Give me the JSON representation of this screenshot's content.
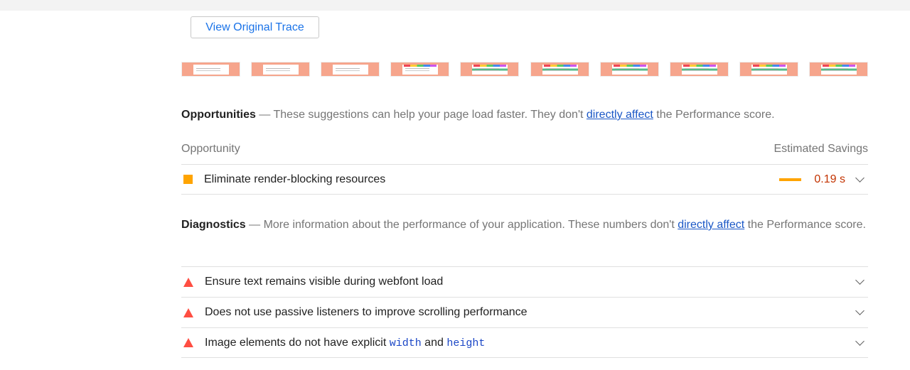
{
  "trace_button": {
    "label": "View Original Trace"
  },
  "filmstrip": {
    "frames": [
      "plain",
      "plain",
      "plain",
      "rich",
      "green",
      "green",
      "green",
      "green",
      "green",
      "green"
    ]
  },
  "opportunities": {
    "title": "Opportunities",
    "dash": " — ",
    "desc_before": "These suggestions can help your page load faster. They don't ",
    "link": "directly affect",
    "desc_after": " the Performance score.",
    "col_left": "Opportunity",
    "col_right": "Estimated Savings",
    "items": [
      {
        "label": "Eliminate render-blocking resources",
        "savings": "0.19 s",
        "savings_fraction": 0.2,
        "status_color": "#ffa400"
      }
    ]
  },
  "diagnostics": {
    "title": "Diagnostics",
    "dash": " — ",
    "desc_before": "More information about the performance of your application. These numbers don't ",
    "link": "directly affect",
    "desc_after": " the Performance score.",
    "items": [
      {
        "label": "Ensure text remains visible during webfont load"
      },
      {
        "label": "Does not use passive listeners to improve scrolling performance"
      },
      {
        "label_before": "Image elements do not have explicit ",
        "code1": "width",
        "label_mid": " and ",
        "code2": "height"
      }
    ],
    "status_color": "#ff4e42"
  },
  "icons": {
    "opportunity": "orange-square-icon",
    "diagnostic": "red-triangle-icon",
    "expand": "chevron-down-icon"
  }
}
